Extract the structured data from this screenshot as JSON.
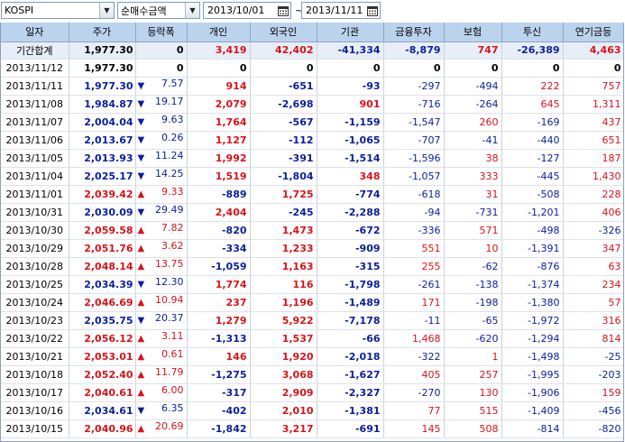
{
  "toolbar": {
    "index_select": "KOSPI",
    "metric_select": "순매수금액",
    "date_from": "2013/10/01",
    "date_separator": "~",
    "date_to": "2013/11/11"
  },
  "colors": {
    "up": "#d8131a",
    "down": "#0a1f9c",
    "header_bg": "#bcd3ee"
  },
  "columns": [
    "일자",
    "주가",
    "등락폭",
    "개인",
    "외국인",
    "기관",
    "금융투자",
    "보험",
    "투신",
    "연기금등"
  ],
  "rows": [
    {
      "date": "기간합계",
      "price": "1,977.30",
      "dir": "",
      "chg": "0",
      "ind": "3,419",
      "for": "42,402",
      "inst": "-41,334",
      "fin": "-8,879",
      "ins": "747",
      "trust": "-26,389",
      "pension": "4,463"
    },
    {
      "date": "2013/11/12",
      "price": "1,977.30",
      "dir": "",
      "chg": "0",
      "ind": "0",
      "for": "0",
      "inst": "0",
      "fin": "0",
      "ins": "0",
      "trust": "0",
      "pension": "0"
    },
    {
      "date": "2013/11/11",
      "price": "1,977.30",
      "dir": "down",
      "chg": "7.57",
      "ind": "914",
      "for": "-651",
      "inst": "-93",
      "fin": "-297",
      "ins": "-494",
      "trust": "222",
      "pension": "757"
    },
    {
      "date": "2013/11/08",
      "price": "1,984.87",
      "dir": "down",
      "chg": "19.17",
      "ind": "2,079",
      "for": "-2,698",
      "inst": "901",
      "fin": "-716",
      "ins": "-264",
      "trust": "645",
      "pension": "1,311"
    },
    {
      "date": "2013/11/07",
      "price": "2,004.04",
      "dir": "down",
      "chg": "9.63",
      "ind": "1,764",
      "for": "-567",
      "inst": "-1,159",
      "fin": "-1,547",
      "ins": "260",
      "trust": "-169",
      "pension": "437"
    },
    {
      "date": "2013/11/06",
      "price": "2,013.67",
      "dir": "down",
      "chg": "0.26",
      "ind": "1,127",
      "for": "-112",
      "inst": "-1,065",
      "fin": "-707",
      "ins": "-41",
      "trust": "-440",
      "pension": "651"
    },
    {
      "date": "2013/11/05",
      "price": "2,013.93",
      "dir": "down",
      "chg": "11.24",
      "ind": "1,992",
      "for": "-391",
      "inst": "-1,514",
      "fin": "-1,596",
      "ins": "38",
      "trust": "-127",
      "pension": "187"
    },
    {
      "date": "2013/11/04",
      "price": "2,025.17",
      "dir": "down",
      "chg": "14.25",
      "ind": "1,519",
      "for": "-1,804",
      "inst": "348",
      "fin": "-1,057",
      "ins": "333",
      "trust": "-445",
      "pension": "1,430"
    },
    {
      "date": "2013/11/01",
      "price": "2,039.42",
      "dir": "up",
      "chg": "9.33",
      "ind": "-889",
      "for": "1,725",
      "inst": "-774",
      "fin": "-618",
      "ins": "31",
      "trust": "-508",
      "pension": "228"
    },
    {
      "date": "2013/10/31",
      "price": "2,030.09",
      "dir": "down",
      "chg": "29.49",
      "ind": "2,404",
      "for": "-245",
      "inst": "-2,288",
      "fin": "-94",
      "ins": "-731",
      "trust": "-1,201",
      "pension": "406"
    },
    {
      "date": "2013/10/30",
      "price": "2,059.58",
      "dir": "up",
      "chg": "7.82",
      "ind": "-820",
      "for": "1,473",
      "inst": "-672",
      "fin": "-336",
      "ins": "571",
      "trust": "-498",
      "pension": "-326"
    },
    {
      "date": "2013/10/29",
      "price": "2,051.76",
      "dir": "up",
      "chg": "3.62",
      "ind": "-334",
      "for": "1,233",
      "inst": "-909",
      "fin": "551",
      "ins": "10",
      "trust": "-1,391",
      "pension": "347"
    },
    {
      "date": "2013/10/28",
      "price": "2,048.14",
      "dir": "up",
      "chg": "13.75",
      "ind": "-1,059",
      "for": "1,163",
      "inst": "-315",
      "fin": "255",
      "ins": "-62",
      "trust": "-876",
      "pension": "63"
    },
    {
      "date": "2013/10/25",
      "price": "2,034.39",
      "dir": "down",
      "chg": "12.30",
      "ind": "1,774",
      "for": "116",
      "inst": "-1,798",
      "fin": "-261",
      "ins": "-138",
      "trust": "-1,374",
      "pension": "234"
    },
    {
      "date": "2013/10/24",
      "price": "2,046.69",
      "dir": "up",
      "chg": "10.94",
      "ind": "237",
      "for": "1,196",
      "inst": "-1,489",
      "fin": "171",
      "ins": "-198",
      "trust": "-1,380",
      "pension": "57"
    },
    {
      "date": "2013/10/23",
      "price": "2,035.75",
      "dir": "down",
      "chg": "20.37",
      "ind": "1,279",
      "for": "5,922",
      "inst": "-7,178",
      "fin": "-11",
      "ins": "-65",
      "trust": "-1,972",
      "pension": "316"
    },
    {
      "date": "2013/10/22",
      "price": "2,056.12",
      "dir": "up",
      "chg": "3.11",
      "ind": "-1,313",
      "for": "1,537",
      "inst": "-66",
      "fin": "1,468",
      "ins": "-620",
      "trust": "-1,294",
      "pension": "814"
    },
    {
      "date": "2013/10/21",
      "price": "2,053.01",
      "dir": "up",
      "chg": "0.61",
      "ind": "146",
      "for": "1,920",
      "inst": "-2,018",
      "fin": "-322",
      "ins": "1",
      "trust": "-1,498",
      "pension": "-25"
    },
    {
      "date": "2013/10/18",
      "price": "2,052.40",
      "dir": "up",
      "chg": "11.79",
      "ind": "-1,275",
      "for": "3,068",
      "inst": "-1,627",
      "fin": "405",
      "ins": "257",
      "trust": "-1,995",
      "pension": "-203"
    },
    {
      "date": "2013/10/17",
      "price": "2,040.61",
      "dir": "up",
      "chg": "6.00",
      "ind": "-317",
      "for": "2,909",
      "inst": "-2,327",
      "fin": "-270",
      "ins": "130",
      "trust": "-1,906",
      "pension": "159"
    },
    {
      "date": "2013/10/16",
      "price": "2,034.61",
      "dir": "down",
      "chg": "6.35",
      "ind": "-402",
      "for": "2,010",
      "inst": "-1,381",
      "fin": "77",
      "ins": "515",
      "trust": "-1,409",
      "pension": "-456"
    },
    {
      "date": "2013/10/15",
      "price": "2,040.96",
      "dir": "up",
      "chg": "20.69",
      "ind": "-1,842",
      "for": "3,217",
      "inst": "-691",
      "fin": "145",
      "ins": "508",
      "trust": "-814",
      "pension": "-820"
    }
  ]
}
